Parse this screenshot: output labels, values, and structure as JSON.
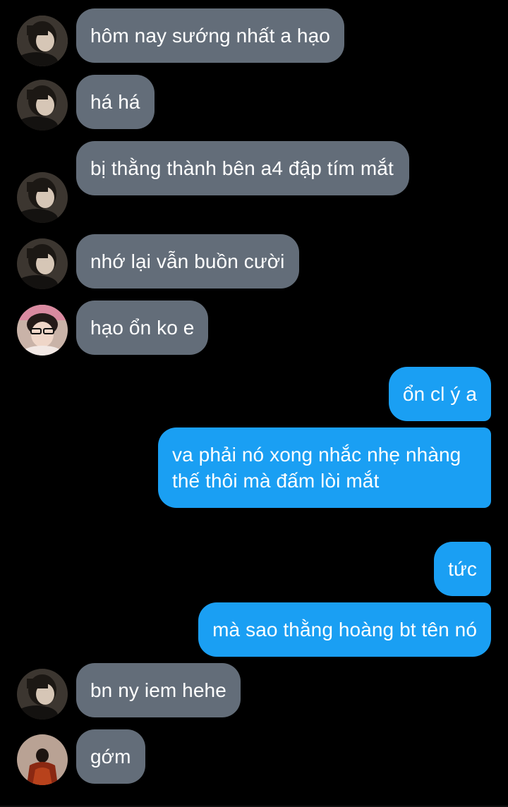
{
  "conversation": {
    "messages": [
      {
        "side": "in",
        "sender": "friend",
        "text": "hôm nay sướng nhất a hạo"
      },
      {
        "side": "in",
        "sender": "friend",
        "text": "há há"
      },
      {
        "side": "in",
        "sender": "friend",
        "text": "bị thằng thành bên a4 đập tím mắt"
      },
      {
        "side": "in",
        "sender": "friend",
        "text": "nhớ lại vẫn buồn cười"
      },
      {
        "side": "in",
        "sender": "friend-2",
        "text": "hạo ổn ko e"
      },
      {
        "side": "out",
        "sender": "me",
        "text": "ổn cl ý a"
      },
      {
        "side": "out",
        "sender": "me",
        "text": "va phải nó xong nhắc nhẹ nhàng thế thôi mà đấm lòi mắt"
      },
      {
        "side": "out",
        "sender": "me",
        "text": "tức"
      },
      {
        "side": "out",
        "sender": "me",
        "text": "mà sao thằng hoàng bt tên nó"
      },
      {
        "side": "in",
        "sender": "friend",
        "text": "bn ny iem hehe"
      },
      {
        "side": "in",
        "sender": "friend-3",
        "text": "gớm"
      }
    ]
  },
  "colors": {
    "background": "#000000",
    "incoming_bubble": "#636d79",
    "outgoing_bubble": "#1a9ff3",
    "text": "#ffffff"
  },
  "icons": {
    "avatar_friend": "user-avatar-icon",
    "avatar_friend_2": "user-avatar-icon",
    "avatar_friend_3": "user-avatar-icon"
  }
}
